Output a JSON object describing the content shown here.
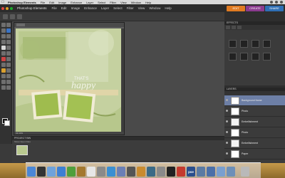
{
  "menubar": {
    "apple": "",
    "items": [
      "Photoshop Elements",
      "File",
      "Edit",
      "Image",
      "Enhance",
      "Layer",
      "Select",
      "Filter",
      "View",
      "Window",
      "Help"
    ]
  },
  "app": {
    "title": "Photoshop Elements",
    "menu": [
      "File",
      "Edit",
      "Image",
      "Enhance",
      "Layer",
      "Select",
      "Filter",
      "View",
      "Window",
      "Help"
    ],
    "modes": [
      {
        "label": "EDIT",
        "color": "#e07b22"
      },
      {
        "label": "CREATE",
        "color": "#8b3b8f"
      },
      {
        "label": "SHARE",
        "color": "#2f6fb5"
      }
    ]
  },
  "document": {
    "canvas_text": "happy",
    "canvas_subtext": "THAT'S",
    "status": "33.33%"
  },
  "project_bin": {
    "title": "PROJECT BIN",
    "subtitle": "Show Open Files"
  },
  "panels": {
    "effects_title": "EFFECTS",
    "layers_title": "LAYERS",
    "layers": [
      {
        "name": "Background frame",
        "selected": true,
        "thumb_color": "#ffffff"
      },
      {
        "name": "Photo",
        "selected": false,
        "thumb_color": "#ffffff"
      },
      {
        "name": "Embellishment",
        "selected": false,
        "thumb_color": "#f4f4f4"
      },
      {
        "name": "Photo",
        "selected": false,
        "thumb_color": "#ffffff"
      },
      {
        "name": "Embellishment",
        "selected": false,
        "thumb_color": "#f4f4f4"
      },
      {
        "name": "Paper",
        "selected": false,
        "thumb_color": "#ffffff"
      }
    ]
  },
  "dock": {
    "icons": [
      {
        "name": "finder-icon",
        "color": "#4b87d6",
        "label": ""
      },
      {
        "name": "dashboard-icon",
        "color": "#333333",
        "label": ""
      },
      {
        "name": "mail-icon",
        "color": "#6fa2db",
        "label": ""
      },
      {
        "name": "safari-icon",
        "color": "#3d7fd3",
        "label": ""
      },
      {
        "name": "ichat-icon",
        "color": "#4f9f3c",
        "label": ""
      },
      {
        "name": "address-book-icon",
        "color": "#a3782f",
        "label": ""
      },
      {
        "name": "ical-icon",
        "color": "#e7e7e7",
        "label": ""
      },
      {
        "name": "preview-icon",
        "color": "#8a8a8a",
        "label": ""
      },
      {
        "name": "itunes-icon",
        "color": "#3b8fd2",
        "label": ""
      },
      {
        "name": "iphoto-icon",
        "color": "#6b7fb5",
        "label": ""
      },
      {
        "name": "imovie-icon",
        "color": "#555555",
        "label": ""
      },
      {
        "name": "garageband-icon",
        "color": "#c98b2f",
        "label": ""
      },
      {
        "name": "time-machine-icon",
        "color": "#3b6a86",
        "label": ""
      },
      {
        "name": "system-preferences-icon",
        "color": "#8a8a8a",
        "label": ""
      },
      {
        "name": "terminal-icon",
        "color": "#222222",
        "label": ""
      },
      {
        "name": "pdf-icon",
        "color": "#c43a2f",
        "label": ""
      },
      {
        "name": "photoshop-elements-icon",
        "color": "#2a4e8c",
        "label": "pse"
      },
      {
        "name": "preview-2-icon",
        "color": "#5b7aa3",
        "label": ""
      },
      {
        "name": "app-blue-icon",
        "color": "#4b6fa8",
        "label": ""
      },
      {
        "name": "folder-icon",
        "color": "#7a9fcf",
        "label": ""
      },
      {
        "name": "downloads-icon",
        "color": "#6d8fb8",
        "label": ""
      },
      {
        "name": "trash-icon",
        "color": "#b9b9b9",
        "label": ""
      }
    ]
  }
}
